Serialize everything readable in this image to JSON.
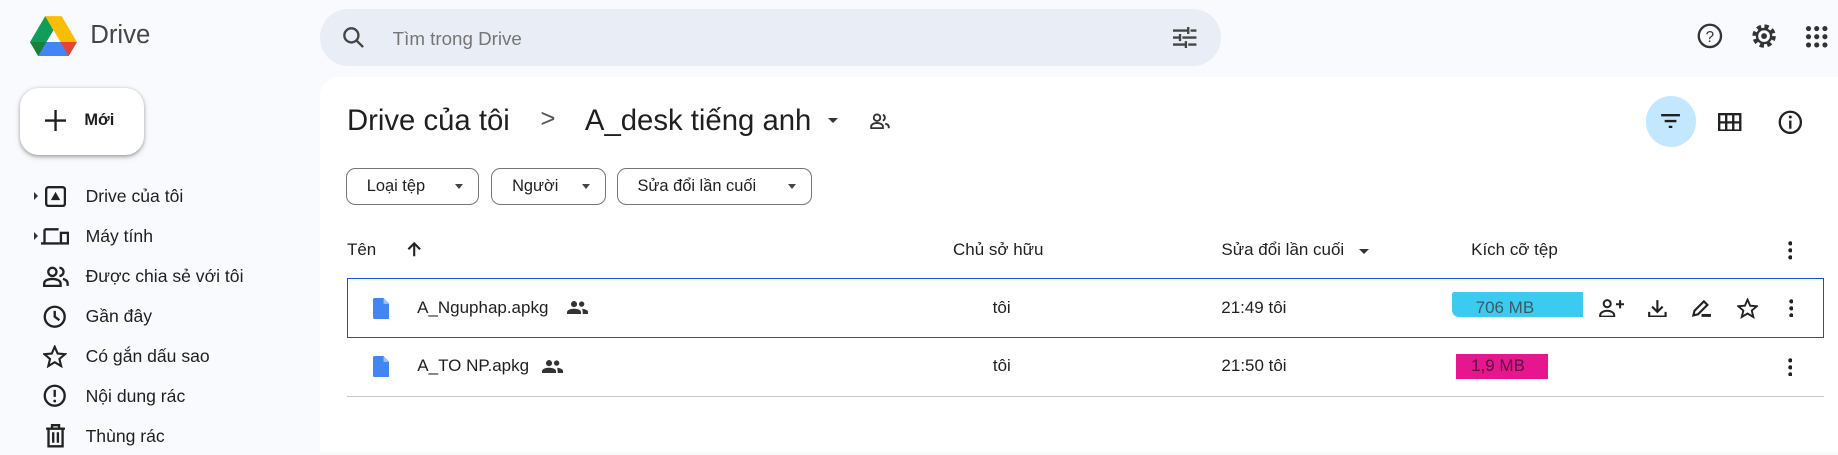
{
  "app": {
    "name": "Drive"
  },
  "search": {
    "placeholder": "Tìm trong Drive"
  },
  "new_button": {
    "label": "Mới"
  },
  "sidebar": {
    "items": [
      {
        "label": "Drive của tôi",
        "icon": "my-drive-icon"
      },
      {
        "label": "Máy tính",
        "icon": "computer-icon"
      },
      {
        "label": "Được chia sẻ với tôi",
        "icon": "shared-icon"
      },
      {
        "label": "Gần đây",
        "icon": "clock-icon"
      },
      {
        "label": "Có gắn dấu sao",
        "icon": "star-icon"
      },
      {
        "label": "Nội dung rác",
        "icon": "spam-icon"
      },
      {
        "label": "Thùng rác",
        "icon": "trash-icon"
      }
    ]
  },
  "breadcrumb": {
    "root": "Drive của tôi",
    "separator": ">",
    "current": "A_desk tiếng anh"
  },
  "filters": [
    "Loại tệp",
    "Người",
    "Sửa đổi lần cuối"
  ],
  "table": {
    "headers": {
      "name": "Tên",
      "owner": "Chủ sở hữu",
      "modified": "Sửa đổi lần cuối",
      "size": "Kích cỡ tệp"
    },
    "rows": [
      {
        "name": "A_Nguphap.apkg",
        "owner": "tôi",
        "modified": "21:49 tôi",
        "size": "706 MB",
        "highlight": "#3ccbf0"
      },
      {
        "name": "A_TO NP.apkg",
        "owner": "tôi",
        "modified": "21:50 tôi",
        "size": "1,9 MB",
        "highlight": "#e6168f"
      }
    ]
  },
  "colors": {
    "accent": "#0b57d0",
    "active_filter_bg": "#c2e7ff"
  }
}
